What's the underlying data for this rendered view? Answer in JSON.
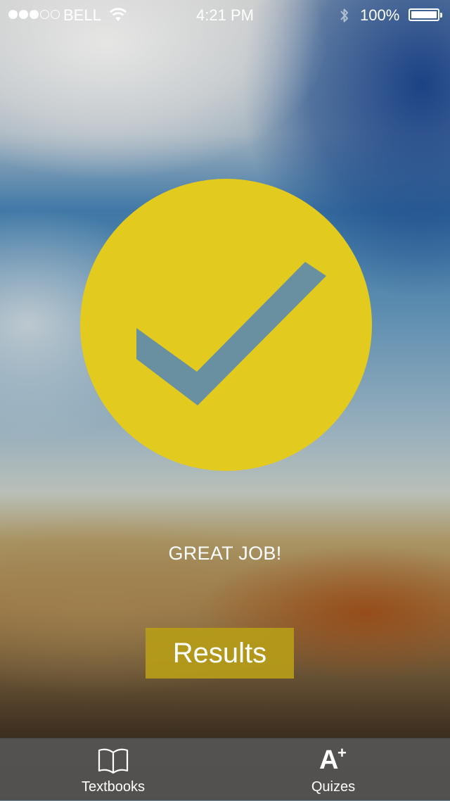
{
  "status_bar": {
    "carrier": "BELL",
    "signal_bars_filled": 3,
    "signal_bars_total": 5,
    "time": "4:21 PM",
    "battery_percent": "100%",
    "battery_level": 1.0,
    "icons": [
      "signal-dots-icon",
      "wifi-icon",
      "bluetooth-icon",
      "battery-icon"
    ]
  },
  "result": {
    "icon": "checkmark-icon",
    "message": "GREAT JOB!",
    "button_label": "Results"
  },
  "tab_bar": {
    "tabs": [
      {
        "label": "Textbooks",
        "icon": "open-book-icon"
      },
      {
        "label": "Quizes",
        "icon": "a-plus-icon",
        "icon_text": "A",
        "icon_superscript": "+"
      }
    ]
  },
  "colors": {
    "accent_yellow": "#E2CA1F",
    "button_gold": "#B69C18",
    "tab_bar_bg": "#585858",
    "text": "#FFFFFF"
  }
}
